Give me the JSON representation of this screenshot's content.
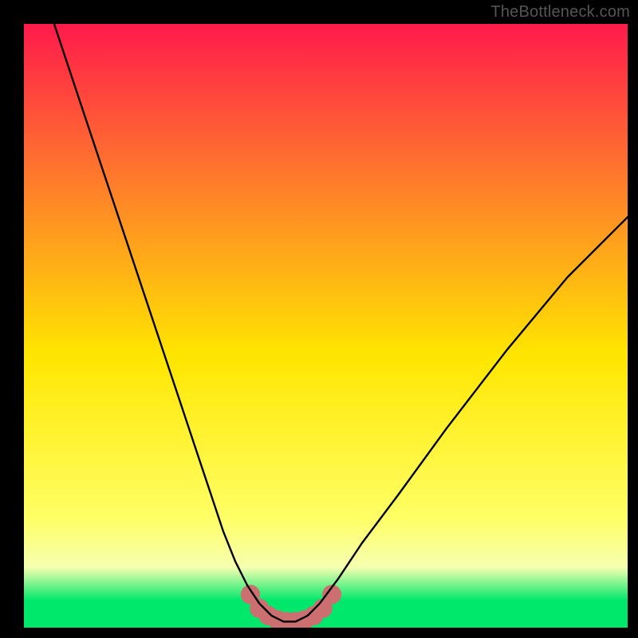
{
  "watermark": "TheBottleneck.com",
  "colors": {
    "frame": "#000000",
    "grad_top": "#ff1a4b",
    "grad_mid_upper": "#ff7f2a",
    "grad_mid": "#ffe600",
    "grad_lower_yellow": "#ffff66",
    "grad_pale": "#f6ffb0",
    "grad_green": "#00e86b",
    "curve": "#000000",
    "bump": "#cc6f70"
  },
  "chart_data": {
    "type": "line",
    "title": "",
    "xlabel": "",
    "ylabel": "",
    "x_range": [
      0,
      100
    ],
    "y_range": [
      0,
      100
    ],
    "series": [
      {
        "name": "bottleneck-curve",
        "x": [
          5,
          9,
          13,
          17,
          21,
          25,
          29,
          31,
          33,
          35,
          37,
          39,
          41,
          43,
          45,
          47,
          49,
          52,
          56,
          62,
          70,
          80,
          90,
          100
        ],
        "y": [
          100,
          88,
          76,
          64,
          52,
          40,
          28,
          22,
          16,
          11,
          7,
          4,
          2,
          1,
          1,
          2,
          4,
          8,
          14,
          22,
          33,
          46,
          58,
          68
        ]
      }
    ],
    "bump_points": {
      "name": "valley-markers",
      "x": [
        37.5,
        39.0,
        40.5,
        42.0,
        43.5,
        45.0,
        46.5,
        48.0,
        49.5,
        51.0
      ],
      "y": [
        5.5,
        3.2,
        2.0,
        1.3,
        1.0,
        1.0,
        1.3,
        2.0,
        3.2,
        5.5
      ],
      "radius_pct": 1.6
    },
    "gradient_stops": [
      {
        "offset": 0.0,
        "color_key": "grad_top"
      },
      {
        "offset": 0.27,
        "color_key": "grad_mid_upper"
      },
      {
        "offset": 0.55,
        "color_key": "grad_mid"
      },
      {
        "offset": 0.82,
        "color_key": "grad_lower_yellow"
      },
      {
        "offset": 0.9,
        "color_key": "grad_pale"
      },
      {
        "offset": 0.955,
        "color_key": "grad_green"
      },
      {
        "offset": 1.0,
        "color_key": "grad_green"
      }
    ]
  }
}
